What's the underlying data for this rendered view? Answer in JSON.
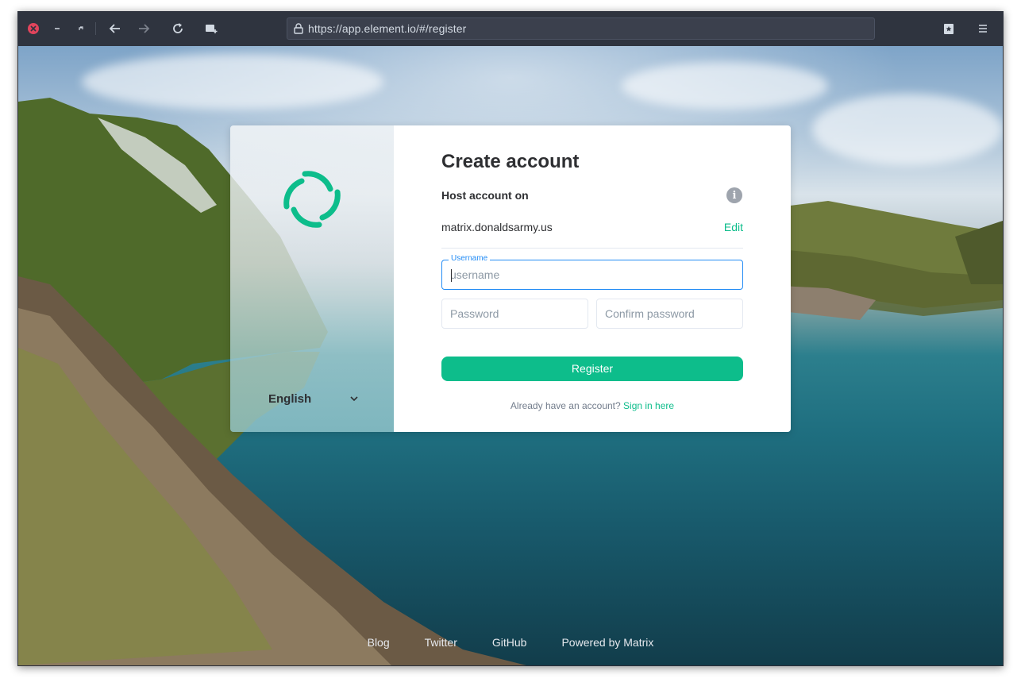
{
  "browser": {
    "url": "https://app.element.io/#/register",
    "icons": {
      "close": "close-icon",
      "minimize": "minimize-icon",
      "restore": "restore-icon",
      "back": "back-arrow-icon",
      "forward": "forward-arrow-icon",
      "reload": "reload-icon",
      "screenshot": "screenshot-icon",
      "lock": "lock-icon",
      "bookmark": "bookmark-star-icon",
      "menu": "hamburger-menu-icon"
    }
  },
  "auth": {
    "title": "Create account",
    "host_label": "Host account on",
    "server": "matrix.donaldsarmy.us",
    "edit_label": "Edit",
    "username": {
      "label": "Username",
      "placeholder": "username",
      "value": ""
    },
    "password": {
      "placeholder": "Password"
    },
    "confirm_password": {
      "placeholder": "Confirm password"
    },
    "register_label": "Register",
    "signin_prompt": "Already have an account?",
    "signin_link": "Sign in here"
  },
  "language": {
    "selected": "English"
  },
  "footer": {
    "links": [
      "Blog",
      "Twitter",
      "GitHub",
      "Powered by Matrix"
    ]
  },
  "colors": {
    "accent": "#0dbd8b",
    "focus": "#238cf5",
    "text": "#2e2f32",
    "muted": "#737d8c",
    "chrome": "#2f343f"
  }
}
